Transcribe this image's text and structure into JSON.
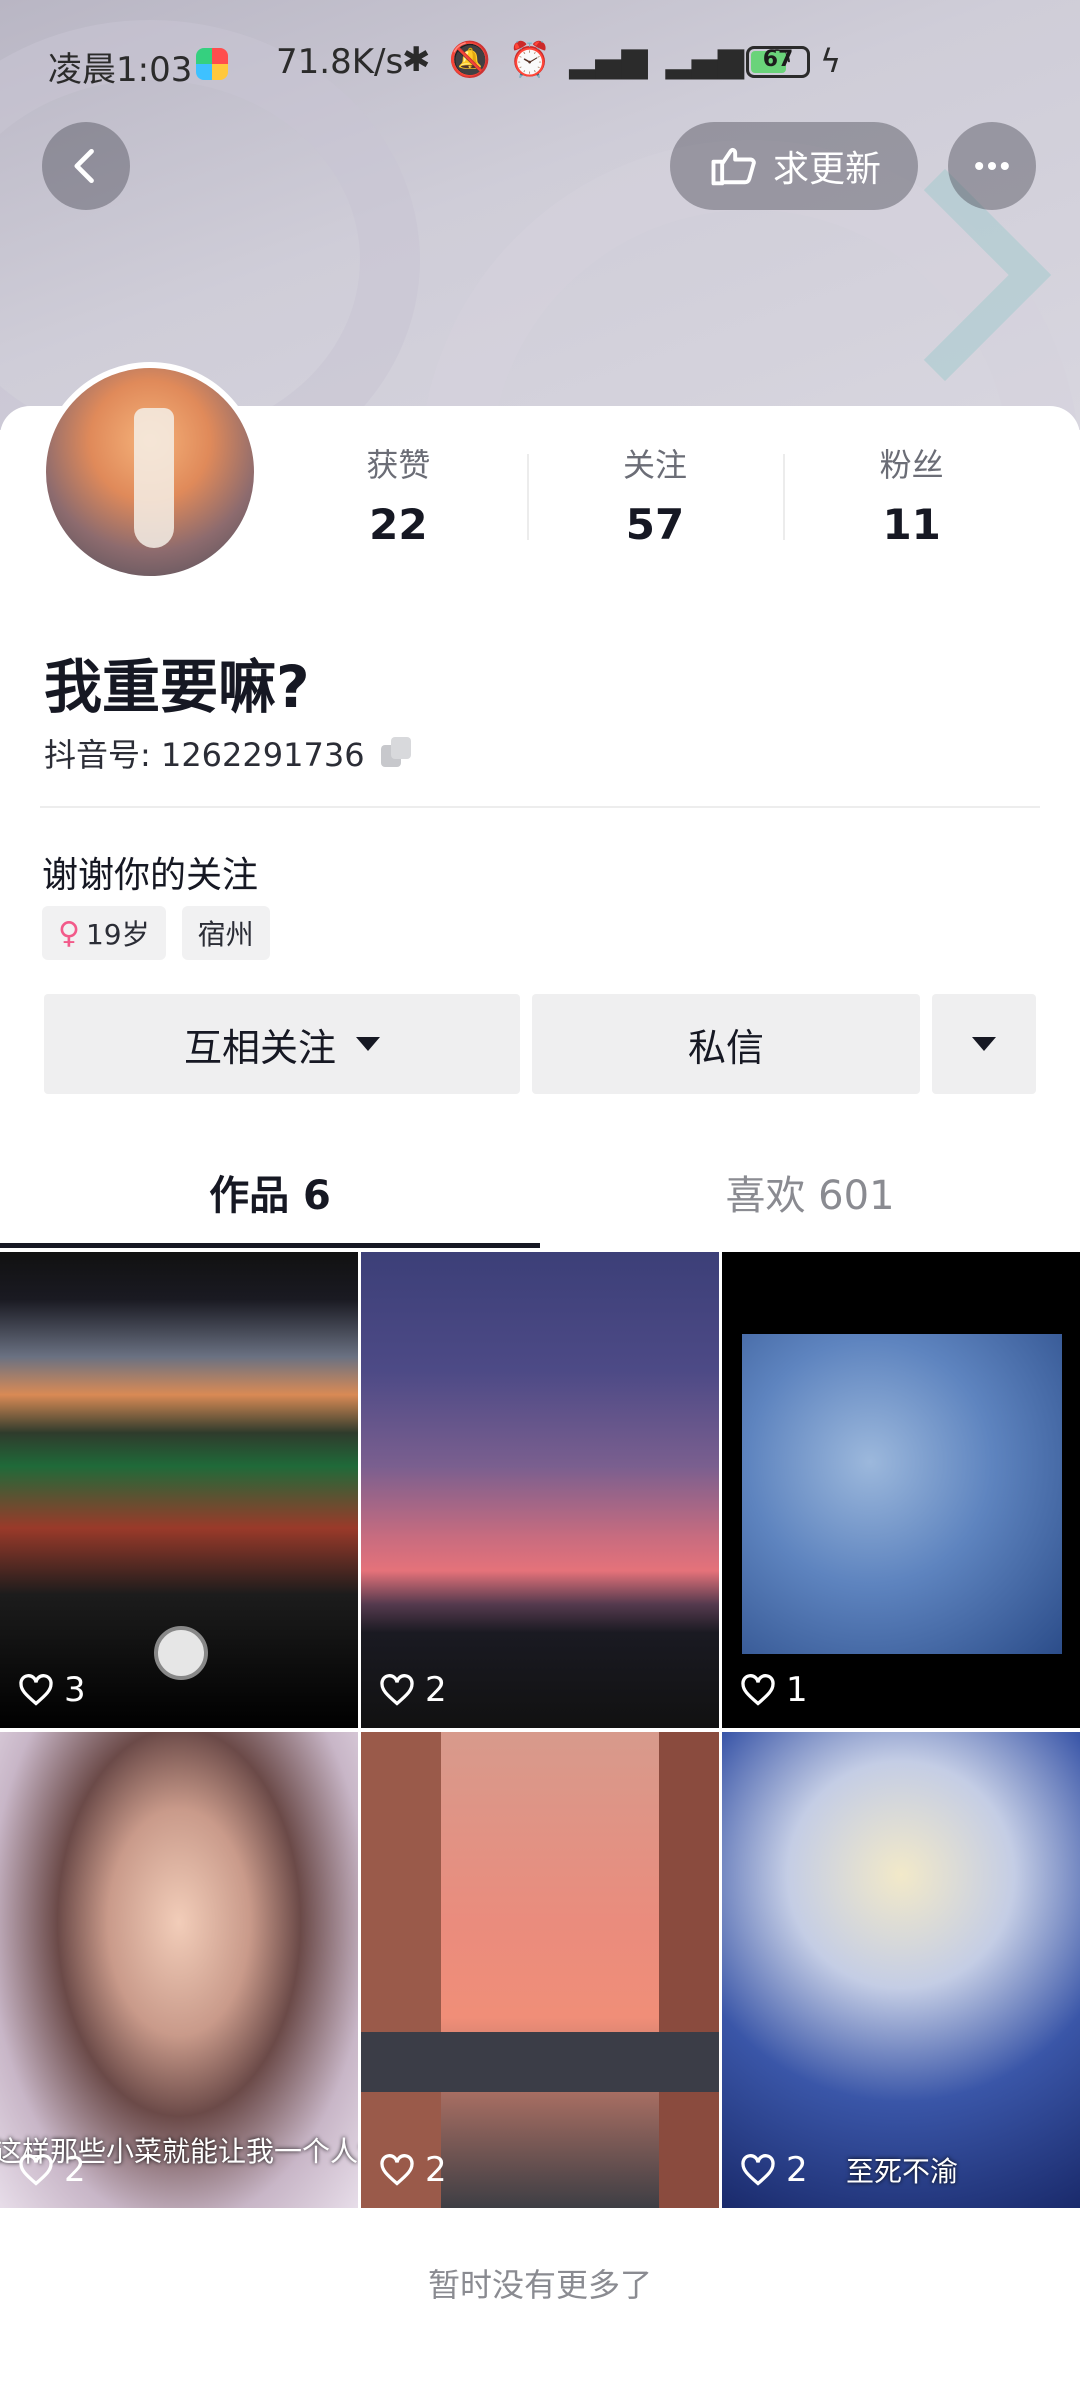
{
  "status_bar": {
    "time": "凌晨1:03",
    "net_speed": "71.8K/s",
    "battery": "67",
    "icons": [
      "bluetooth-icon",
      "mute-icon",
      "alarm-icon",
      "signal-icon",
      "signal-icon",
      "wifi-icon",
      "battery-icon",
      "charging-icon"
    ]
  },
  "header": {
    "update_label": "求更新"
  },
  "profile": {
    "stats": [
      {
        "label": "获赞",
        "value": "22"
      },
      {
        "label": "关注",
        "value": "57"
      },
      {
        "label": "粉丝",
        "value": "11"
      }
    ],
    "name": "我重要嘛?",
    "id_label": "抖音号: 1262291736",
    "bio": "谢谢你的关注",
    "tags": {
      "age": "19岁",
      "city": "宿州"
    }
  },
  "actions": {
    "follow_label": "互相关注",
    "message_label": "私信"
  },
  "tabs": [
    {
      "label": "作品 6"
    },
    {
      "label": "喜欢 601"
    }
  ],
  "videos": [
    {
      "likes": "3",
      "caption": ""
    },
    {
      "likes": "2",
      "caption": ""
    },
    {
      "likes": "1",
      "caption": ""
    },
    {
      "likes": "2",
      "caption": "这样那些小菜就能让我一个人包了"
    },
    {
      "likes": "2",
      "caption": ""
    },
    {
      "likes": "2",
      "caption": "至死不渝"
    }
  ],
  "footer_text": "暂时没有更多了",
  "colors": {
    "text": "#161823",
    "muted": "#8a8b91",
    "button_bg": "#efeff0"
  }
}
